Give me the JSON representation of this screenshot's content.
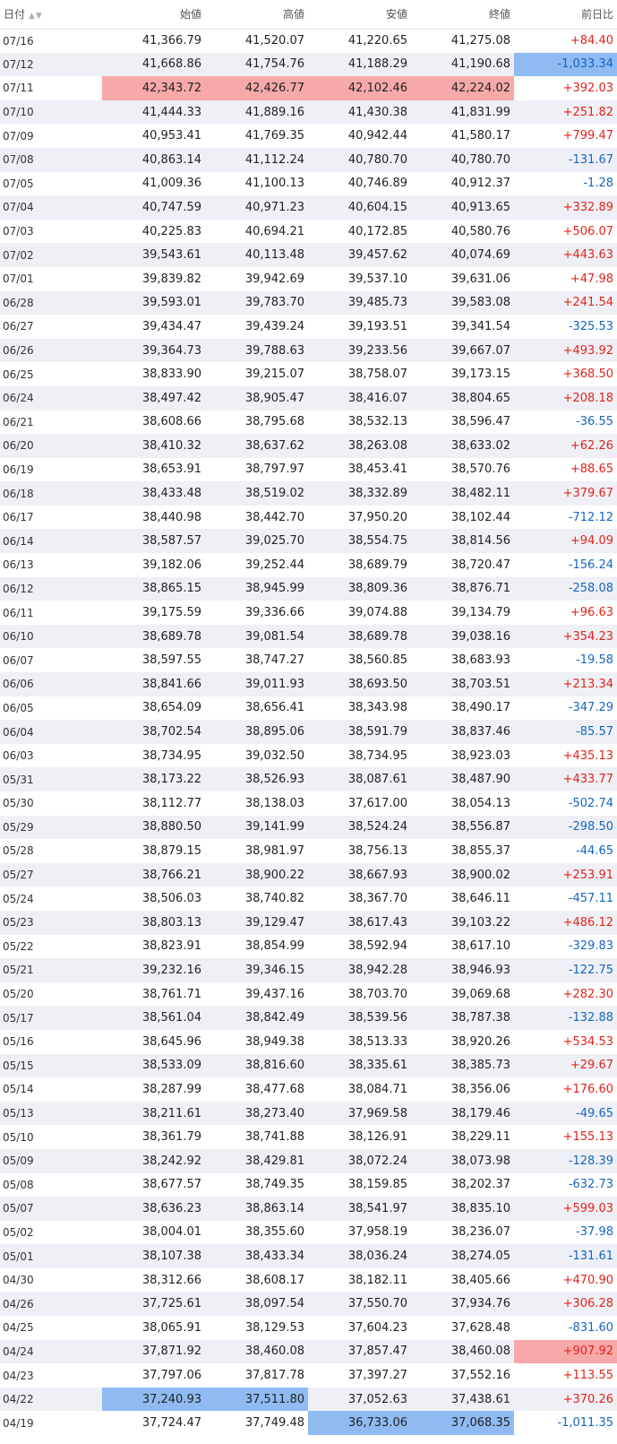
{
  "headers": {
    "date": "日付",
    "open": "始値",
    "high": "高値",
    "low": "安値",
    "close": "終値",
    "change": "前日比"
  },
  "sort_icons": "▲▼",
  "colors": {
    "positive": "#e2231a",
    "negative": "#1565c0",
    "highlight_max": "#f7a9a9",
    "highlight_min": "#8fbbf2",
    "stripe": "#eef0f5"
  },
  "rows": [
    {
      "date": "07/16",
      "open": "41,366.79",
      "high": "41,520.07",
      "low": "41,220.65",
      "close": "41,275.08",
      "change": "+84.40"
    },
    {
      "date": "07/12",
      "open": "41,668.86",
      "high": "41,754.76",
      "low": "41,188.29",
      "close": "41,190.68",
      "change": "-1,033.34",
      "hl": {
        "change": "min"
      }
    },
    {
      "date": "07/11",
      "open": "42,343.72",
      "high": "42,426.77",
      "low": "42,102.46",
      "close": "42,224.02",
      "change": "+392.03",
      "hl": {
        "open": "max",
        "high": "max",
        "low": "max",
        "close": "max"
      }
    },
    {
      "date": "07/10",
      "open": "41,444.33",
      "high": "41,889.16",
      "low": "41,430.38",
      "close": "41,831.99",
      "change": "+251.82"
    },
    {
      "date": "07/09",
      "open": "40,953.41",
      "high": "41,769.35",
      "low": "40,942.44",
      "close": "41,580.17",
      "change": "+799.47"
    },
    {
      "date": "07/08",
      "open": "40,863.14",
      "high": "41,112.24",
      "low": "40,780.70",
      "close": "40,780.70",
      "change": "-131.67"
    },
    {
      "date": "07/05",
      "open": "41,009.36",
      "high": "41,100.13",
      "low": "40,746.89",
      "close": "40,912.37",
      "change": "-1.28"
    },
    {
      "date": "07/04",
      "open": "40,747.59",
      "high": "40,971.23",
      "low": "40,604.15",
      "close": "40,913.65",
      "change": "+332.89"
    },
    {
      "date": "07/03",
      "open": "40,225.83",
      "high": "40,694.21",
      "low": "40,172.85",
      "close": "40,580.76",
      "change": "+506.07"
    },
    {
      "date": "07/02",
      "open": "39,543.61",
      "high": "40,113.48",
      "low": "39,457.62",
      "close": "40,074.69",
      "change": "+443.63"
    },
    {
      "date": "07/01",
      "open": "39,839.82",
      "high": "39,942.69",
      "low": "39,537.10",
      "close": "39,631.06",
      "change": "+47.98"
    },
    {
      "date": "06/28",
      "open": "39,593.01",
      "high": "39,783.70",
      "low": "39,485.73",
      "close": "39,583.08",
      "change": "+241.54"
    },
    {
      "date": "06/27",
      "open": "39,434.47",
      "high": "39,439.24",
      "low": "39,193.51",
      "close": "39,341.54",
      "change": "-325.53"
    },
    {
      "date": "06/26",
      "open": "39,364.73",
      "high": "39,788.63",
      "low": "39,233.56",
      "close": "39,667.07",
      "change": "+493.92"
    },
    {
      "date": "06/25",
      "open": "38,833.90",
      "high": "39,215.07",
      "low": "38,758.07",
      "close": "39,173.15",
      "change": "+368.50"
    },
    {
      "date": "06/24",
      "open": "38,497.42",
      "high": "38,905.47",
      "low": "38,416.07",
      "close": "38,804.65",
      "change": "+208.18"
    },
    {
      "date": "06/21",
      "open": "38,608.66",
      "high": "38,795.68",
      "low": "38,532.13",
      "close": "38,596.47",
      "change": "-36.55"
    },
    {
      "date": "06/20",
      "open": "38,410.32",
      "high": "38,637.62",
      "low": "38,263.08",
      "close": "38,633.02",
      "change": "+62.26"
    },
    {
      "date": "06/19",
      "open": "38,653.91",
      "high": "38,797.97",
      "low": "38,453.41",
      "close": "38,570.76",
      "change": "+88.65"
    },
    {
      "date": "06/18",
      "open": "38,433.48",
      "high": "38,519.02",
      "low": "38,332.89",
      "close": "38,482.11",
      "change": "+379.67"
    },
    {
      "date": "06/17",
      "open": "38,440.98",
      "high": "38,442.70",
      "low": "37,950.20",
      "close": "38,102.44",
      "change": "-712.12"
    },
    {
      "date": "06/14",
      "open": "38,587.57",
      "high": "39,025.70",
      "low": "38,554.75",
      "close": "38,814.56",
      "change": "+94.09"
    },
    {
      "date": "06/13",
      "open": "39,182.06",
      "high": "39,252.44",
      "low": "38,689.79",
      "close": "38,720.47",
      "change": "-156.24"
    },
    {
      "date": "06/12",
      "open": "38,865.15",
      "high": "38,945.99",
      "low": "38,809.36",
      "close": "38,876.71",
      "change": "-258.08"
    },
    {
      "date": "06/11",
      "open": "39,175.59",
      "high": "39,336.66",
      "low": "39,074.88",
      "close": "39,134.79",
      "change": "+96.63"
    },
    {
      "date": "06/10",
      "open": "38,689.78",
      "high": "39,081.54",
      "low": "38,689.78",
      "close": "39,038.16",
      "change": "+354.23"
    },
    {
      "date": "06/07",
      "open": "38,597.55",
      "high": "38,747.27",
      "low": "38,560.85",
      "close": "38,683.93",
      "change": "-19.58"
    },
    {
      "date": "06/06",
      "open": "38,841.66",
      "high": "39,011.93",
      "low": "38,693.50",
      "close": "38,703.51",
      "change": "+213.34"
    },
    {
      "date": "06/05",
      "open": "38,654.09",
      "high": "38,656.41",
      "low": "38,343.98",
      "close": "38,490.17",
      "change": "-347.29"
    },
    {
      "date": "06/04",
      "open": "38,702.54",
      "high": "38,895.06",
      "low": "38,591.79",
      "close": "38,837.46",
      "change": "-85.57"
    },
    {
      "date": "06/03",
      "open": "38,734.95",
      "high": "39,032.50",
      "low": "38,734.95",
      "close": "38,923.03",
      "change": "+435.13"
    },
    {
      "date": "05/31",
      "open": "38,173.22",
      "high": "38,526.93",
      "low": "38,087.61",
      "close": "38,487.90",
      "change": "+433.77"
    },
    {
      "date": "05/30",
      "open": "38,112.77",
      "high": "38,138.03",
      "low": "37,617.00",
      "close": "38,054.13",
      "change": "-502.74"
    },
    {
      "date": "05/29",
      "open": "38,880.50",
      "high": "39,141.99",
      "low": "38,524.24",
      "close": "38,556.87",
      "change": "-298.50"
    },
    {
      "date": "05/28",
      "open": "38,879.15",
      "high": "38,981.97",
      "low": "38,756.13",
      "close": "38,855.37",
      "change": "-44.65"
    },
    {
      "date": "05/27",
      "open": "38,766.21",
      "high": "38,900.22",
      "low": "38,667.93",
      "close": "38,900.02",
      "change": "+253.91"
    },
    {
      "date": "05/24",
      "open": "38,506.03",
      "high": "38,740.82",
      "low": "38,367.70",
      "close": "38,646.11",
      "change": "-457.11"
    },
    {
      "date": "05/23",
      "open": "38,803.13",
      "high": "39,129.47",
      "low": "38,617.43",
      "close": "39,103.22",
      "change": "+486.12"
    },
    {
      "date": "05/22",
      "open": "38,823.91",
      "high": "38,854.99",
      "low": "38,592.94",
      "close": "38,617.10",
      "change": "-329.83"
    },
    {
      "date": "05/21",
      "open": "39,232.16",
      "high": "39,346.15",
      "low": "38,942.28",
      "close": "38,946.93",
      "change": "-122.75"
    },
    {
      "date": "05/20",
      "open": "38,761.71",
      "high": "39,437.16",
      "low": "38,703.70",
      "close": "39,069.68",
      "change": "+282.30"
    },
    {
      "date": "05/17",
      "open": "38,561.04",
      "high": "38,842.49",
      "low": "38,539.56",
      "close": "38,787.38",
      "change": "-132.88"
    },
    {
      "date": "05/16",
      "open": "38,645.96",
      "high": "38,949.38",
      "low": "38,513.33",
      "close": "38,920.26",
      "change": "+534.53"
    },
    {
      "date": "05/15",
      "open": "38,533.09",
      "high": "38,816.60",
      "low": "38,335.61",
      "close": "38,385.73",
      "change": "+29.67"
    },
    {
      "date": "05/14",
      "open": "38,287.99",
      "high": "38,477.68",
      "low": "38,084.71",
      "close": "38,356.06",
      "change": "+176.60"
    },
    {
      "date": "05/13",
      "open": "38,211.61",
      "high": "38,273.40",
      "low": "37,969.58",
      "close": "38,179.46",
      "change": "-49.65"
    },
    {
      "date": "05/10",
      "open": "38,361.79",
      "high": "38,741.88",
      "low": "38,126.91",
      "close": "38,229.11",
      "change": "+155.13"
    },
    {
      "date": "05/09",
      "open": "38,242.92",
      "high": "38,429.81",
      "low": "38,072.24",
      "close": "38,073.98",
      "change": "-128.39"
    },
    {
      "date": "05/08",
      "open": "38,677.57",
      "high": "38,749.35",
      "low": "38,159.85",
      "close": "38,202.37",
      "change": "-632.73"
    },
    {
      "date": "05/07",
      "open": "38,636.23",
      "high": "38,863.14",
      "low": "38,541.97",
      "close": "38,835.10",
      "change": "+599.03"
    },
    {
      "date": "05/02",
      "open": "38,004.01",
      "high": "38,355.60",
      "low": "37,958.19",
      "close": "38,236.07",
      "change": "-37.98"
    },
    {
      "date": "05/01",
      "open": "38,107.38",
      "high": "38,433.34",
      "low": "38,036.24",
      "close": "38,274.05",
      "change": "-131.61"
    },
    {
      "date": "04/30",
      "open": "38,312.66",
      "high": "38,608.17",
      "low": "38,182.11",
      "close": "38,405.66",
      "change": "+470.90"
    },
    {
      "date": "04/26",
      "open": "37,725.61",
      "high": "38,097.54",
      "low": "37,550.70",
      "close": "37,934.76",
      "change": "+306.28"
    },
    {
      "date": "04/25",
      "open": "38,065.91",
      "high": "38,129.53",
      "low": "37,604.23",
      "close": "37,628.48",
      "change": "-831.60"
    },
    {
      "date": "04/24",
      "open": "37,871.92",
      "high": "38,460.08",
      "low": "37,857.47",
      "close": "38,460.08",
      "change": "+907.92",
      "hl": {
        "change": "max"
      }
    },
    {
      "date": "04/23",
      "open": "37,797.06",
      "high": "37,817.78",
      "low": "37,397.27",
      "close": "37,552.16",
      "change": "+113.55"
    },
    {
      "date": "04/22",
      "open": "37,240.93",
      "high": "37,511.80",
      "low": "37,052.63",
      "close": "37,438.61",
      "change": "+370.26",
      "hl": {
        "open": "min",
        "high": "min"
      }
    },
    {
      "date": "04/19",
      "open": "37,724.47",
      "high": "37,749.48",
      "low": "36,733.06",
      "close": "37,068.35",
      "change": "-1,011.35",
      "hl": {
        "low": "min",
        "close": "min"
      }
    }
  ]
}
